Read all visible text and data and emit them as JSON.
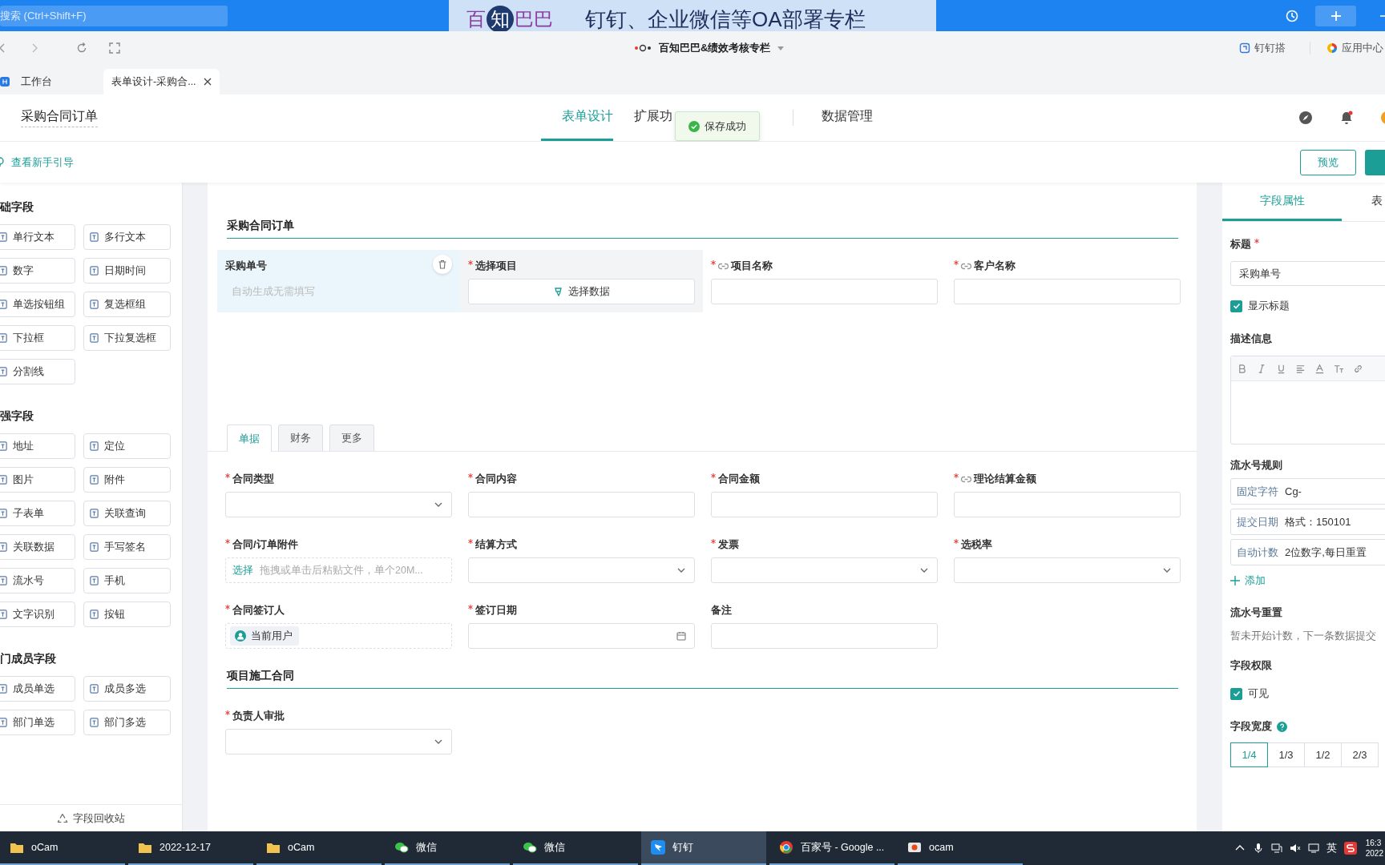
{
  "search": {
    "placeholder": "搜索 (Ctrl+Shift+F)"
  },
  "banner": {
    "brand": "百知巴巴",
    "slogan": "钉钉、企业微信等OA部署专栏"
  },
  "browser_bar": {
    "title": "百知巴巴&绩效考核专栏",
    "links": [
      "钉钉搭",
      "应用中心"
    ]
  },
  "tabs": [
    {
      "label": "工作台",
      "selected": false
    },
    {
      "label": "表单设计-采购合...",
      "selected": true
    }
  ],
  "header": {
    "title": "采购合同订单",
    "toast": "保存成功",
    "nav": [
      {
        "label": "表单设计",
        "selected": true
      },
      {
        "label": "扩展功",
        "selected": false
      },
      {
        "label": "数据管理",
        "selected": false
      }
    ]
  },
  "toolbar": {
    "guide": "查看新手引导",
    "preview": "预览"
  },
  "palette": {
    "groups": [
      {
        "title": "础字段",
        "items": [
          "单行文本",
          "多行文本",
          "数字",
          "日期时间",
          "单选按钮组",
          "复选框组",
          "下拉框",
          "下拉复选框",
          "分割线"
        ]
      },
      {
        "title": "强字段",
        "items": [
          "地址",
          "定位",
          "图片",
          "附件",
          "子表单",
          "关联查询",
          "关联数据",
          "手写签名",
          "流水号",
          "手机",
          "文字识别",
          "按钮"
        ]
      },
      {
        "title": "门成员字段",
        "items": [
          "成员单选",
          "成员多选",
          "部门单选",
          "部门多选"
        ]
      }
    ],
    "recycle": "字段回收站"
  },
  "form": {
    "section": "采购合同订单",
    "top_fields": [
      {
        "label": "采购单号",
        "required": false,
        "linked": false,
        "kind": "auto",
        "placeholder": "自动生成无需填写",
        "selected": true,
        "hovered": false
      },
      {
        "label": "选择项目",
        "required": true,
        "linked": false,
        "kind": "picker",
        "button": "选择数据",
        "selected": false,
        "hovered": true
      },
      {
        "label": "项目名称",
        "required": true,
        "linked": true,
        "kind": "input",
        "selected": false,
        "hovered": false
      },
      {
        "label": "客户名称",
        "required": true,
        "linked": true,
        "kind": "input",
        "selected": false,
        "hovered": false
      }
    ],
    "tabs": [
      {
        "label": "单据",
        "selected": true
      },
      {
        "label": "财务",
        "selected": false
      },
      {
        "label": "更多",
        "selected": false
      }
    ],
    "fields": [
      {
        "label": "合同类型",
        "required": true,
        "linked": false,
        "kind": "select"
      },
      {
        "label": "合同内容",
        "required": true,
        "linked": false,
        "kind": "input"
      },
      {
        "label": "合同金额",
        "required": true,
        "linked": false,
        "kind": "input"
      },
      {
        "label": "理论结算金额",
        "required": true,
        "linked": true,
        "kind": "input"
      },
      {
        "label": "合同/订单附件",
        "required": true,
        "linked": false,
        "kind": "upload",
        "action": "选择",
        "placeholder": "拖拽或单击后粘贴文件，单个20M..."
      },
      {
        "label": "结算方式",
        "required": true,
        "linked": false,
        "kind": "select"
      },
      {
        "label": "发票",
        "required": true,
        "linked": false,
        "kind": "select"
      },
      {
        "label": "选税率",
        "required": true,
        "linked": false,
        "kind": "select"
      },
      {
        "label": "合同签订人",
        "required": true,
        "linked": false,
        "kind": "user",
        "chip": "当前用户"
      },
      {
        "label": "签订日期",
        "required": true,
        "linked": false,
        "kind": "date"
      },
      {
        "label": "备注",
        "required": false,
        "linked": false,
        "kind": "input"
      }
    ],
    "section2": "项目施工合同",
    "fields2": [
      {
        "label": "负责人审批",
        "required": true,
        "linked": false,
        "kind": "select"
      }
    ]
  },
  "properties": {
    "tabs": [
      {
        "label": "字段属性",
        "selected": true
      },
      {
        "label": "表",
        "selected": false
      }
    ],
    "title_label": "标题",
    "title_value": "采购单号",
    "show_title": {
      "label": "显示标题",
      "checked": true
    },
    "description_label": "描述信息",
    "serial_label": "流水号规则",
    "serial_rules": [
      {
        "type": "固定字符",
        "value": "Cg-"
      },
      {
        "type": "提交日期",
        "value": "格式：150101"
      },
      {
        "type": "自动计数",
        "value": "2位数字,每日重置"
      }
    ],
    "add": "添加",
    "reset_label": "流水号重置",
    "reset_note": "暂未开始计数，下一条数据提交",
    "permission_label": "字段权限",
    "visible": {
      "label": "可见",
      "checked": true
    },
    "width_label": "字段宽度",
    "widths": [
      {
        "label": "1/4",
        "selected": true
      },
      {
        "label": "1/3",
        "selected": false
      },
      {
        "label": "1/2",
        "selected": false
      },
      {
        "label": "2/3",
        "selected": false
      }
    ]
  },
  "taskbar": {
    "items": [
      {
        "label": "oCam",
        "kind": "folder",
        "active": false
      },
      {
        "label": "2022-12-17",
        "kind": "folder",
        "active": false
      },
      {
        "label": "oCam",
        "kind": "folder",
        "active": false
      },
      {
        "label": "微信",
        "kind": "chat",
        "active": false
      },
      {
        "label": "微信",
        "kind": "chat",
        "active": false
      },
      {
        "label": "钉钉",
        "kind": "dingtalk",
        "active": true
      },
      {
        "label": "百家号 - Google ...",
        "kind": "browser",
        "active": false
      },
      {
        "label": "ocam",
        "kind": "camera",
        "active": false
      }
    ],
    "ime": "英",
    "time": "16:3",
    "date": "2022"
  }
}
